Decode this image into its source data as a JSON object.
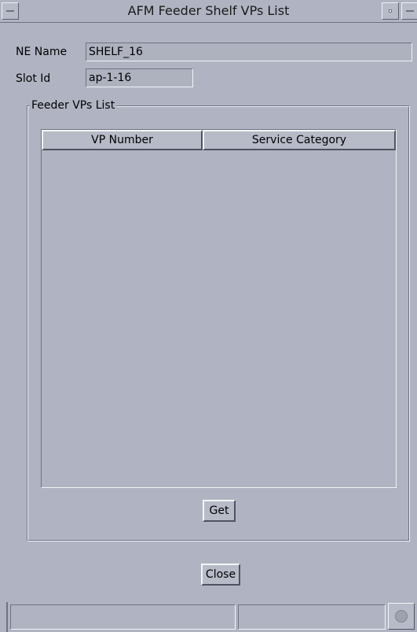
{
  "window": {
    "title": "AFM Feeder Shelf VPs List",
    "controls": {
      "menu_icon": "window-menu-icon",
      "minimize_icon": "minimize-icon",
      "maximize_icon": "maximize-icon"
    }
  },
  "form": {
    "ne_name_label": "NE Name",
    "ne_name_value": "SHELF_16",
    "slot_id_label": "Slot Id",
    "slot_id_value": "ap-1-16"
  },
  "feeder_vps": {
    "group_label": "Feeder VPs List",
    "columns": [
      "VP Number",
      "Service Category"
    ],
    "rows": [],
    "get_label": "Get"
  },
  "footer": {
    "close_label": "Close"
  },
  "status_bar": {
    "cells": [
      "",
      ""
    ],
    "icon": "status-indicator-icon"
  },
  "colors": {
    "background": "#b0b4c2",
    "field_background": "#aeb2bf"
  }
}
